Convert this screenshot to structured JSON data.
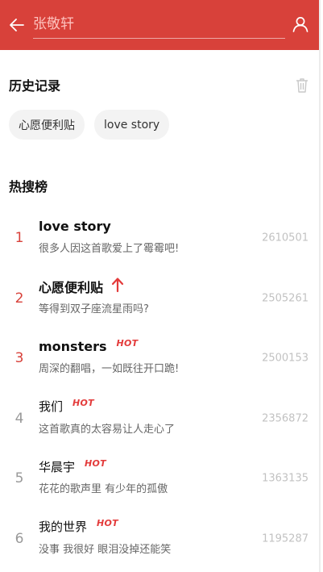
{
  "header": {
    "search_placeholder": "张敬轩",
    "accent_color": "#d8413a",
    "back_icon": "arrow-left-icon",
    "user_icon": "user-icon"
  },
  "history": {
    "title": "历史记录",
    "clear_icon": "trash-icon",
    "tags": [
      "心愿便利贴",
      "love story"
    ]
  },
  "hot_search": {
    "title": "热搜榜",
    "items": [
      {
        "rank": "1",
        "title": "love story",
        "desc": "很多人因这首歌爱上了霉霉吧!",
        "count": "2610501",
        "badge": ""
      },
      {
        "rank": "2",
        "title": "心愿便利贴",
        "desc": "等得到双子座流星雨吗?",
        "count": "2505261",
        "badge": "up-arrow-icon"
      },
      {
        "rank": "3",
        "title": "monsters",
        "desc": "周深的翻唱，一如既往开口跪!",
        "count": "2500153",
        "badge": "HOT"
      },
      {
        "rank": "4",
        "title": "我们",
        "desc": "这首歌真的太容易让人走心了",
        "count": "2356872",
        "badge": "HOT"
      },
      {
        "rank": "5",
        "title": "华晨宇",
        "desc": "花花的歌声里 有少年的孤傲",
        "count": "1363135",
        "badge": "HOT"
      },
      {
        "rank": "6",
        "title": "我的世界",
        "desc": "没事 我很好 眼泪没掉还能笑",
        "count": "1195287",
        "badge": "HOT"
      }
    ]
  }
}
